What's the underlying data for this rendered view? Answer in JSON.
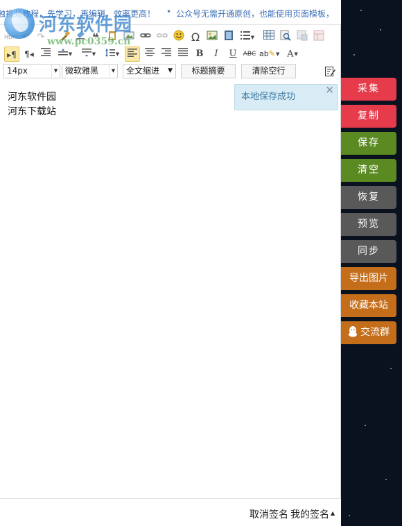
{
  "marquee": {
    "item1": "触视频教程，先学习，再编辑，效率更高！",
    "item2": "公众号无需开通原创，也能使用页面模板，"
  },
  "watermark": {
    "title": "河东软件园",
    "url": "www.pc0359.cn"
  },
  "toolbar": {
    "html_label": "Html",
    "font_size": "14px",
    "font_family": "微软雅黑",
    "indent_label": "全文缩进",
    "summary_button": "标题摘要",
    "clear_lines_button": "清除空行"
  },
  "content": {
    "line1": "河东软件园",
    "line2": "河东下载站"
  },
  "toast": {
    "message": "本地保存成功",
    "close": "×"
  },
  "footer": {
    "cancel_signature": "取消签名",
    "my_signature": "我的签名"
  },
  "side_buttons": {
    "collect": "采集",
    "copy": "复制",
    "save": "保存",
    "clear": "清空",
    "restore": "恢复",
    "preview": "预览",
    "sync": "同步",
    "export_image": "导出图片",
    "bookmark": "收藏本站",
    "group": "交流群"
  },
  "colors": {
    "red": "#e53b4b",
    "green": "#5b8a23",
    "gray": "#595959",
    "orange": "#c46e1c",
    "toast_bg": "#d9ecf6",
    "toast_text": "#3c7aa1"
  }
}
